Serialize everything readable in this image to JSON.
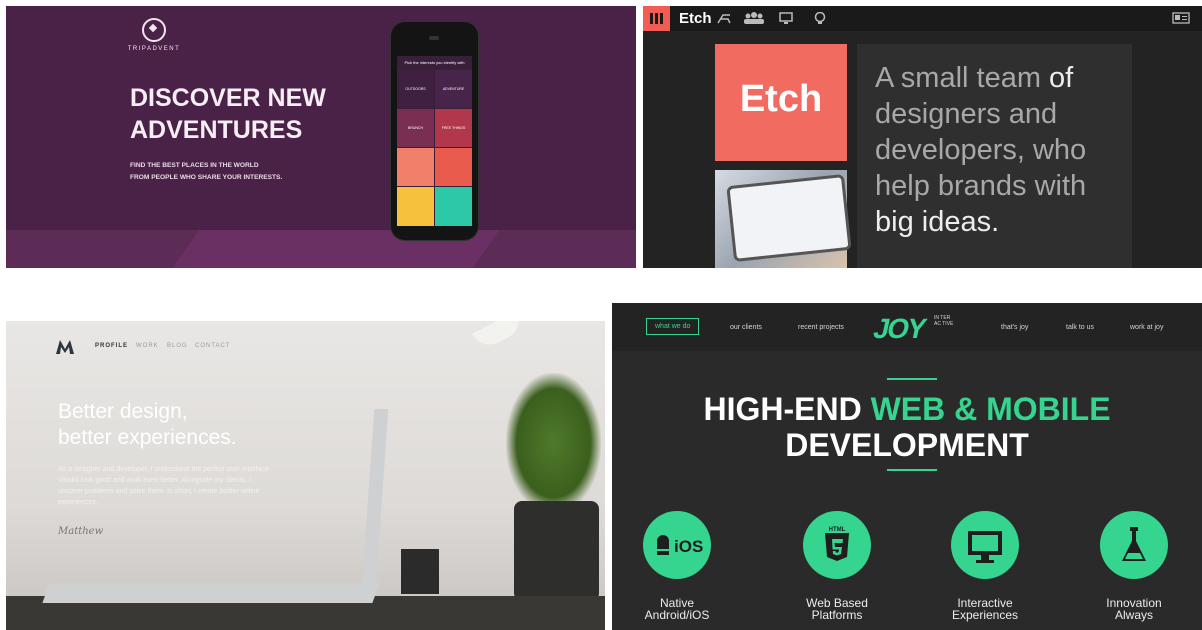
{
  "tripadvent": {
    "brand": "TRIPADVENT",
    "headline_1": "DISCOVER NEW",
    "headline_2": "ADVENTURES",
    "sub_1": "FIND THE BEST PLACES IN THE WORLD",
    "sub_2": "FROM PEOPLE WHO SHARE YOUR INTERESTS.",
    "phone_header": "Pick the interests you identify with",
    "tiles": [
      "OUTDOORS",
      "ADVENTURE",
      "BRUNCH",
      "FREE THINGS",
      "",
      "",
      "",
      ""
    ],
    "accent": "#4a2247"
  },
  "etch": {
    "brand": "Etch",
    "logo_text": "Etch",
    "tagline_1": "A small team",
    "tagline_2": " of",
    "tagline_3": "designers and",
    "tagline_4": "developers, who",
    "tagline_5": "help brands with",
    "tagline_6": "big ideas.",
    "accent": "#f26b60"
  },
  "portfolio": {
    "nav": [
      "PROFILE",
      "WORK",
      "BLOG",
      "CONTACT"
    ],
    "headline_1": "Better design,",
    "headline_2": "better experiences.",
    "para": "As a designer and developer, I understand the perfect user interface should look good and work even better. Alongside my clients, I uncover problems and solve them. In short, I create bolder online experiences.",
    "signature": "Matthew"
  },
  "joy": {
    "nav_left": [
      "what we do",
      "our clients",
      "recent projects"
    ],
    "nav_right": [
      "that's joy",
      "talk to us",
      "work at joy"
    ],
    "logo": "JOY",
    "logo_sub": "IN TER AC TIVE",
    "headline_white_1": "HIGH-END ",
    "headline_green": "WEB & MOBILE",
    "headline_white_2": "DEVELOPMENT",
    "features": [
      {
        "label_1": "Native",
        "label_2": "Android/iOS",
        "icon": "android-ios-icon",
        "icon_text": "iOS"
      },
      {
        "label_1": "Web Based",
        "label_2": "Platforms",
        "icon": "html5-icon",
        "icon_text": "HTML"
      },
      {
        "label_1": "Interactive",
        "label_2": "Experiences",
        "icon": "monitor-icon",
        "icon_text": ""
      },
      {
        "label_1": "Innovation",
        "label_2": "Always",
        "icon": "flask-icon",
        "icon_text": ""
      }
    ],
    "accent": "#35d48f"
  }
}
